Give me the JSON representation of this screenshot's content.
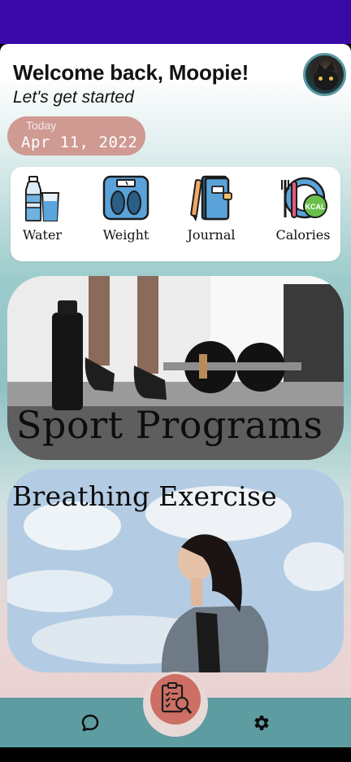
{
  "header": {
    "welcome": "Welcome back, Moopie!",
    "subtitle": "Let's get started"
  },
  "date": {
    "label": "Today",
    "value": "Apr 11, 2022"
  },
  "trackers": [
    {
      "label": "Water",
      "icon": "water-icon"
    },
    {
      "label": "Weight",
      "icon": "scale-icon"
    },
    {
      "label": "Journal",
      "icon": "journal-icon"
    },
    {
      "label": "Calories",
      "icon": "calories-icon"
    }
  ],
  "calories_badge": "KCAL",
  "cards": {
    "sport": {
      "title": "Sport Programs"
    },
    "breathing": {
      "title": "Breathing Exercise"
    }
  },
  "nav": {
    "left_icon": "chat-icon",
    "center_icon": "checklist-search-icon",
    "right_icon": "gear-icon"
  },
  "colors": {
    "statusbar": "#3a0aa8",
    "date_pill": "#cf9a92",
    "bottom_nav": "#5d9ca0",
    "fab": "#cd6f64"
  }
}
